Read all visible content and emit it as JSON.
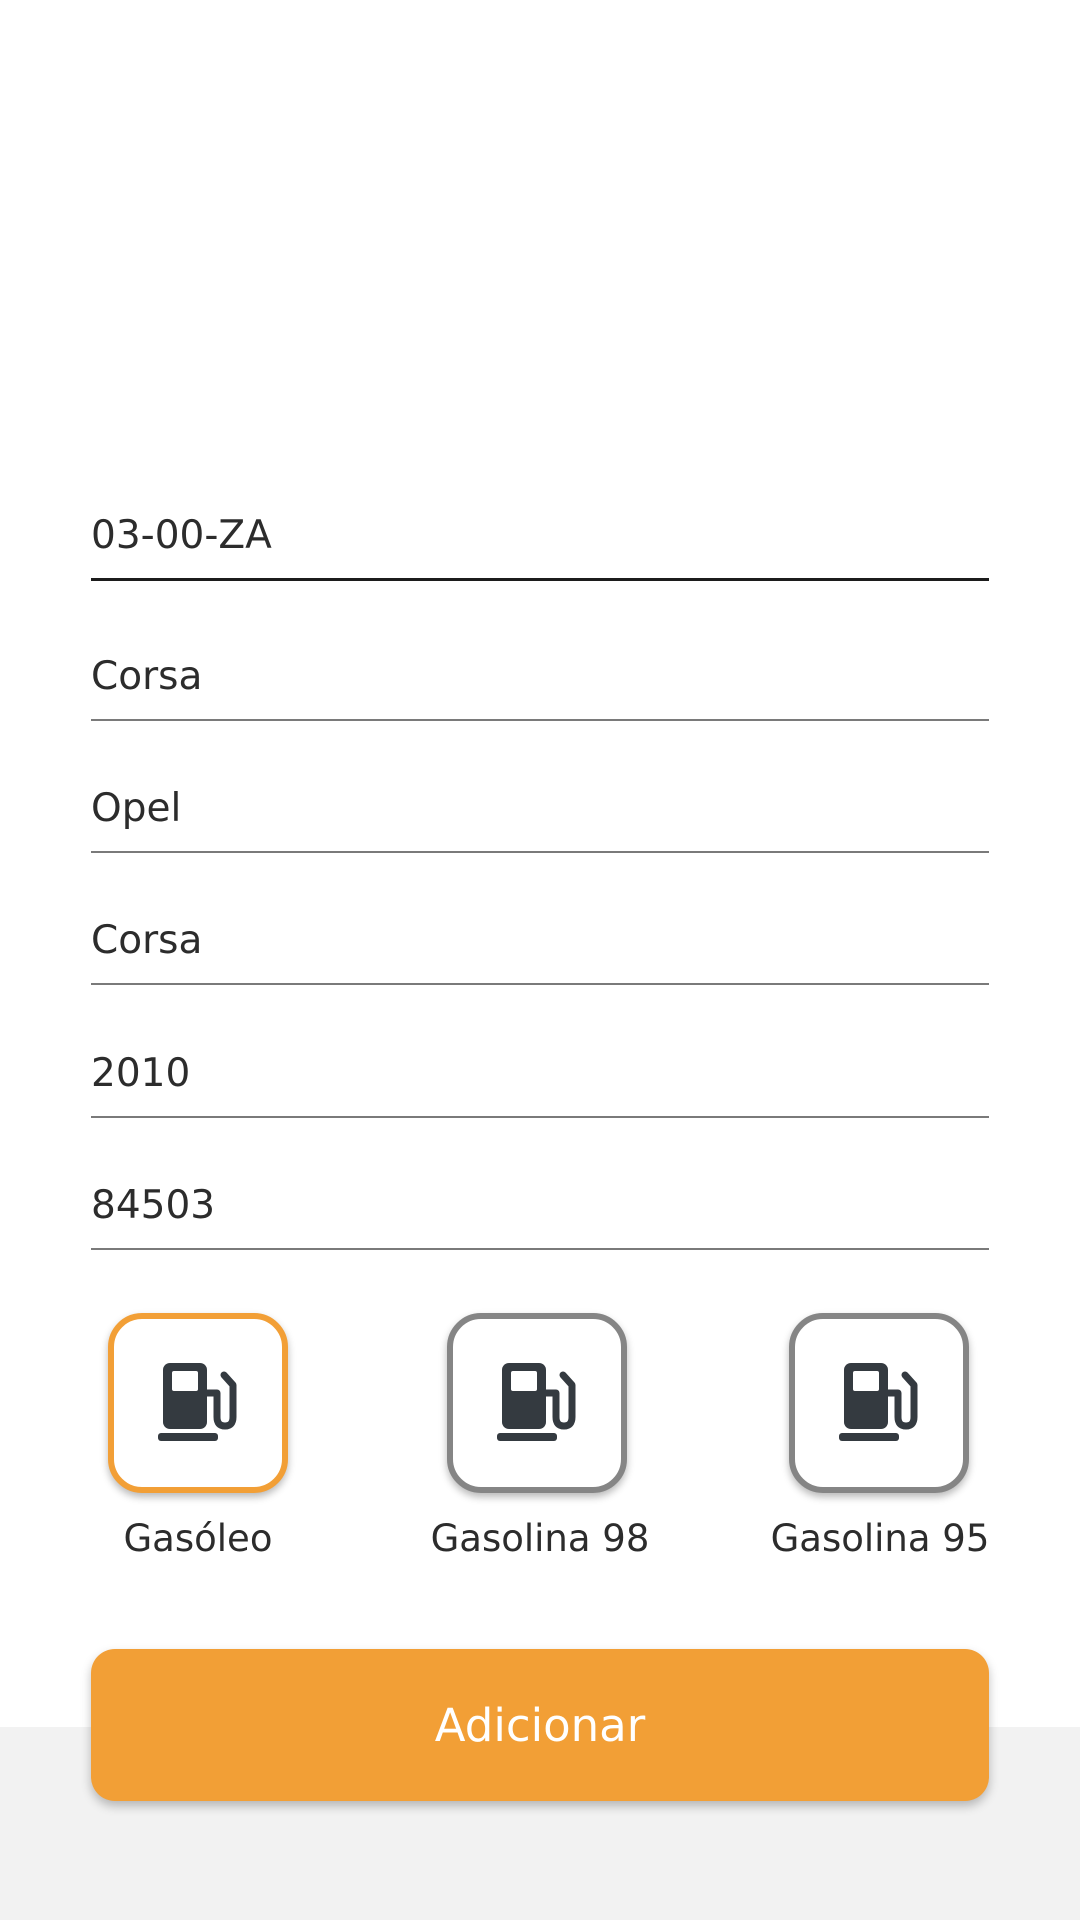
{
  "form": {
    "plate": {
      "value": "03-00-ZA"
    },
    "name": {
      "value": "Corsa"
    },
    "brand": {
      "value": "Opel"
    },
    "model": {
      "value": "Corsa"
    },
    "year": {
      "value": "2010"
    },
    "mileage": {
      "value": "84503"
    }
  },
  "fuel": {
    "selected": "Gasóleo",
    "options": [
      {
        "label": "Gasóleo",
        "icon": "fuel-pump-icon",
        "selected": true
      },
      {
        "label": "Gasolina 98",
        "icon": "fuel-pump-icon",
        "selected": false
      },
      {
        "label": "Gasolina 95",
        "icon": "fuel-pump-icon",
        "selected": false
      }
    ]
  },
  "actions": {
    "add_label": "Adicionar"
  },
  "colors": {
    "accent": "#f29f36",
    "tile_border": "#858585",
    "icon": "#343a40",
    "footer_background": "#f2f2f2"
  }
}
